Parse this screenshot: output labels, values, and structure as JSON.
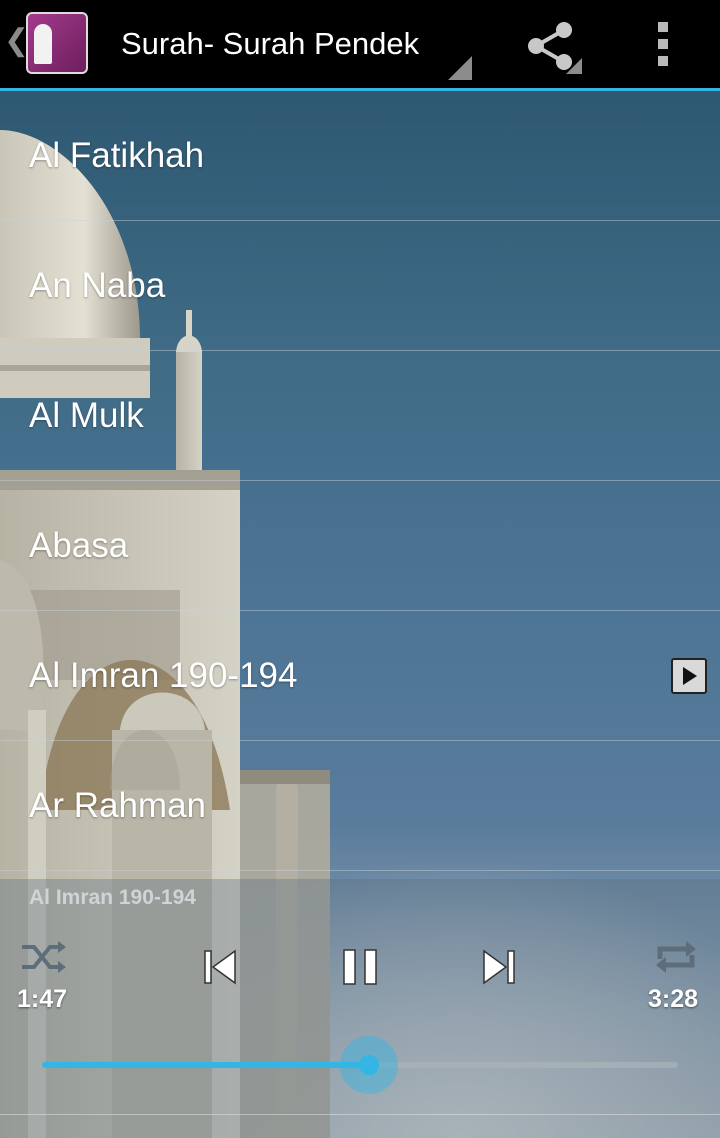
{
  "app": {
    "title": "Surah- Surah Pendek",
    "accent_color": "#33b5e5"
  },
  "actionbar": {
    "up_icon": "chevron-left-icon",
    "app_icon": "app-logo",
    "share_icon": "share-icon",
    "overflow_icon": "more-vertical-icon"
  },
  "surahs": [
    {
      "label": "Al Fatikhah"
    },
    {
      "label": "An Naba"
    },
    {
      "label": "Al Mulk"
    },
    {
      "label": "Abasa"
    },
    {
      "label": "Al Imran 190-194",
      "playing": true
    },
    {
      "label": "Ar Rahman"
    }
  ],
  "player": {
    "now_playing": "Al Imran 190-194",
    "elapsed": "1:47",
    "total": "3:28",
    "progress": 0.5144,
    "controls": [
      "shuffle-icon",
      "previous-icon",
      "pause-icon",
      "next-icon",
      "repeat-icon"
    ]
  }
}
